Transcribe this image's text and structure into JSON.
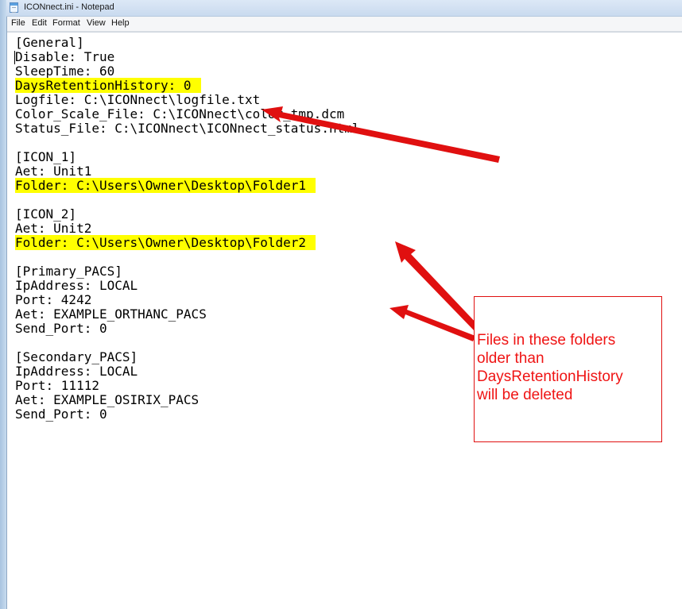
{
  "window": {
    "title": "ICONnect.ini - Notepad"
  },
  "menu": [
    "File",
    "Edit",
    "Format",
    "View",
    "Help"
  ],
  "editor": {
    "lines": [
      {
        "text": "[General]",
        "highlight": false
      },
      {
        "text": "Disable: True",
        "highlight": false
      },
      {
        "text": "SleepTime: 60",
        "highlight": false
      },
      {
        "text": "DaysRetentionHistory: 0",
        "highlight": true
      },
      {
        "text": "Logfile: C:\\ICONnect\\logfile.txt",
        "highlight": false
      },
      {
        "text": "Color_Scale_File: C:\\ICONnect\\color_tmp.dcm",
        "highlight": false
      },
      {
        "text": "Status_File: C:\\ICONnect\\ICONnect_status.html",
        "highlight": false
      },
      {
        "text": "",
        "highlight": false
      },
      {
        "text": "[ICON_1]",
        "highlight": false
      },
      {
        "text": "Aet: Unit1",
        "highlight": false
      },
      {
        "text": "Folder: C:\\Users\\Owner\\Desktop\\Folder1",
        "highlight": true
      },
      {
        "text": "",
        "highlight": false
      },
      {
        "text": "[ICON_2]",
        "highlight": false
      },
      {
        "text": "Aet: Unit2",
        "highlight": false
      },
      {
        "text": "Folder: C:\\Users\\Owner\\Desktop\\Folder2",
        "highlight": true
      },
      {
        "text": "",
        "highlight": false
      },
      {
        "text": "[Primary_PACS]",
        "highlight": false
      },
      {
        "text": "IpAddress: LOCAL",
        "highlight": false
      },
      {
        "text": "Port: 4242",
        "highlight": false
      },
      {
        "text": "Aet: EXAMPLE_ORTHANC_PACS",
        "highlight": false
      },
      {
        "text": "Send_Port: 0",
        "highlight": false
      },
      {
        "text": "",
        "highlight": false
      },
      {
        "text": "[Secondary_PACS]",
        "highlight": false
      },
      {
        "text": "IpAddress: LOCAL",
        "highlight": false
      },
      {
        "text": "Port: 11112",
        "highlight": false
      },
      {
        "text": "Aet: EXAMPLE_OSIRIX_PACS",
        "highlight": false
      },
      {
        "text": "Send_Port: 0",
        "highlight": false
      }
    ]
  },
  "annotation": {
    "callout_text": "Files in these folders\nolder than\nDaysRetentionHistory\nwill be deleted",
    "color": "#e01010",
    "highlight_color": "#ffff00"
  }
}
